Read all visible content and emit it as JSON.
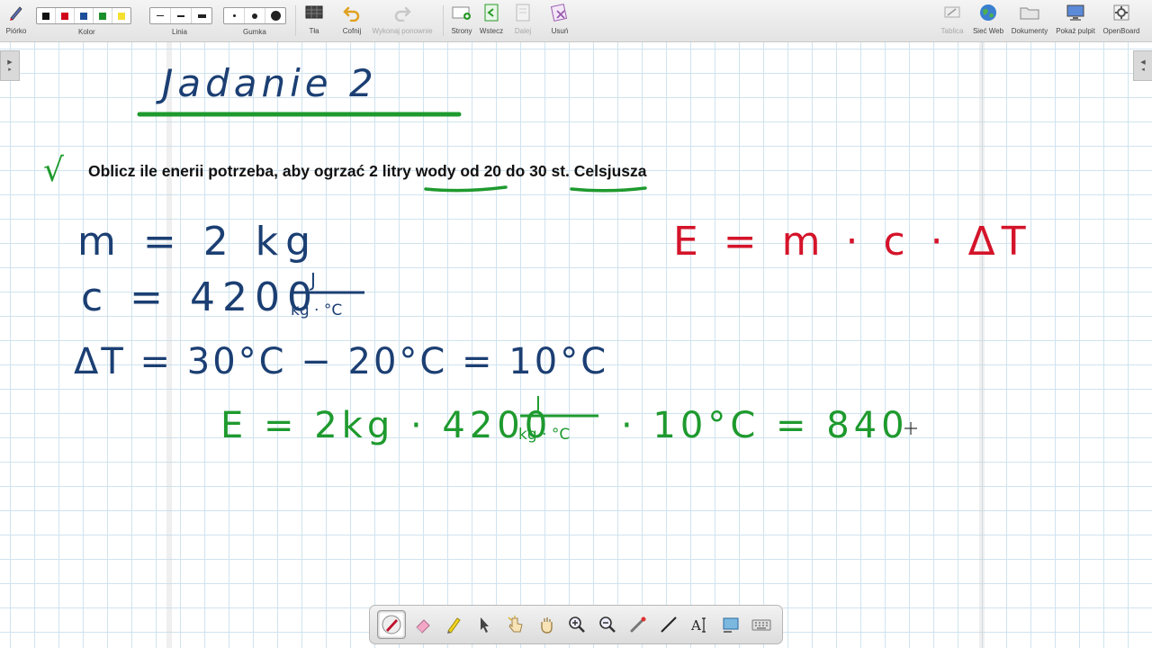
{
  "toolbar": {
    "pen_label": "Piórko",
    "color_label": "Kolor",
    "line_label": "Linia",
    "eraser_label": "Gumka",
    "background_label": "Tła",
    "undo_label": "Cofnij",
    "redo_label": "Wykonaj ponownie",
    "pages_label": "Strony",
    "back_label": "Wstecz",
    "next_label": "Dalej",
    "delete_label": "Usuń",
    "board_label": "Tablica",
    "web_label": "Sieć Web",
    "documents_label": "Dokumenty",
    "desktop_label": "Pokaż pulpit",
    "openboard_label": "OpenBoard",
    "colors": [
      "#111111",
      "#d0021b",
      "#1f4e9a",
      "#1a8f2a",
      "#f5e030"
    ]
  },
  "board": {
    "title": "Jadanie 2",
    "checkmark": "√",
    "task_before": "Oblicz ile enerii potrzeba, aby ogrzać ",
    "task_u1": "2 litry",
    "task_mid1": " wody od ",
    "task_u2": "20 do 30",
    "task_mid2": " st. Celsjusza",
    "line_m": "m = 2 kg",
    "line_c": "c = 4200",
    "unit_num": "J",
    "unit_den": "kg · °C",
    "line_dt": "ΔT = 30°C − 20°C = 10°C",
    "formula": "E = m · c · ΔT",
    "calc_left": "E = 2kg · 4200",
    "calc_right": "· 10°C = 840"
  },
  "colors": {
    "handwriting_blue": "#1b3f73",
    "handwriting_green": "#1e9a2e",
    "handwriting_red": "#d4142a",
    "grid": "#cfe3ef"
  }
}
